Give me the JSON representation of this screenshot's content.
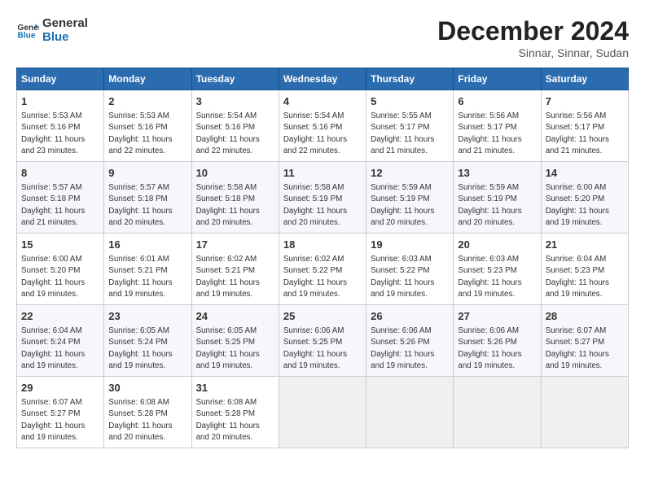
{
  "logo": {
    "line1": "General",
    "line2": "Blue"
  },
  "title": "December 2024",
  "subtitle": "Sinnar, Sinnar, Sudan",
  "days_of_week": [
    "Sunday",
    "Monday",
    "Tuesday",
    "Wednesday",
    "Thursday",
    "Friday",
    "Saturday"
  ],
  "weeks": [
    [
      {
        "day": "1",
        "info": "Sunrise: 5:53 AM\nSunset: 5:16 PM\nDaylight: 11 hours\nand 23 minutes."
      },
      {
        "day": "2",
        "info": "Sunrise: 5:53 AM\nSunset: 5:16 PM\nDaylight: 11 hours\nand 22 minutes."
      },
      {
        "day": "3",
        "info": "Sunrise: 5:54 AM\nSunset: 5:16 PM\nDaylight: 11 hours\nand 22 minutes."
      },
      {
        "day": "4",
        "info": "Sunrise: 5:54 AM\nSunset: 5:16 PM\nDaylight: 11 hours\nand 22 minutes."
      },
      {
        "day": "5",
        "info": "Sunrise: 5:55 AM\nSunset: 5:17 PM\nDaylight: 11 hours\nand 21 minutes."
      },
      {
        "day": "6",
        "info": "Sunrise: 5:56 AM\nSunset: 5:17 PM\nDaylight: 11 hours\nand 21 minutes."
      },
      {
        "day": "7",
        "info": "Sunrise: 5:56 AM\nSunset: 5:17 PM\nDaylight: 11 hours\nand 21 minutes."
      }
    ],
    [
      {
        "day": "8",
        "info": "Sunrise: 5:57 AM\nSunset: 5:18 PM\nDaylight: 11 hours\nand 21 minutes."
      },
      {
        "day": "9",
        "info": "Sunrise: 5:57 AM\nSunset: 5:18 PM\nDaylight: 11 hours\nand 20 minutes."
      },
      {
        "day": "10",
        "info": "Sunrise: 5:58 AM\nSunset: 5:18 PM\nDaylight: 11 hours\nand 20 minutes."
      },
      {
        "day": "11",
        "info": "Sunrise: 5:58 AM\nSunset: 5:19 PM\nDaylight: 11 hours\nand 20 minutes."
      },
      {
        "day": "12",
        "info": "Sunrise: 5:59 AM\nSunset: 5:19 PM\nDaylight: 11 hours\nand 20 minutes."
      },
      {
        "day": "13",
        "info": "Sunrise: 5:59 AM\nSunset: 5:19 PM\nDaylight: 11 hours\nand 20 minutes."
      },
      {
        "day": "14",
        "info": "Sunrise: 6:00 AM\nSunset: 5:20 PM\nDaylight: 11 hours\nand 19 minutes."
      }
    ],
    [
      {
        "day": "15",
        "info": "Sunrise: 6:00 AM\nSunset: 5:20 PM\nDaylight: 11 hours\nand 19 minutes."
      },
      {
        "day": "16",
        "info": "Sunrise: 6:01 AM\nSunset: 5:21 PM\nDaylight: 11 hours\nand 19 minutes."
      },
      {
        "day": "17",
        "info": "Sunrise: 6:02 AM\nSunset: 5:21 PM\nDaylight: 11 hours\nand 19 minutes."
      },
      {
        "day": "18",
        "info": "Sunrise: 6:02 AM\nSunset: 5:22 PM\nDaylight: 11 hours\nand 19 minutes."
      },
      {
        "day": "19",
        "info": "Sunrise: 6:03 AM\nSunset: 5:22 PM\nDaylight: 11 hours\nand 19 minutes."
      },
      {
        "day": "20",
        "info": "Sunrise: 6:03 AM\nSunset: 5:23 PM\nDaylight: 11 hours\nand 19 minutes."
      },
      {
        "day": "21",
        "info": "Sunrise: 6:04 AM\nSunset: 5:23 PM\nDaylight: 11 hours\nand 19 minutes."
      }
    ],
    [
      {
        "day": "22",
        "info": "Sunrise: 6:04 AM\nSunset: 5:24 PM\nDaylight: 11 hours\nand 19 minutes."
      },
      {
        "day": "23",
        "info": "Sunrise: 6:05 AM\nSunset: 5:24 PM\nDaylight: 11 hours\nand 19 minutes."
      },
      {
        "day": "24",
        "info": "Sunrise: 6:05 AM\nSunset: 5:25 PM\nDaylight: 11 hours\nand 19 minutes."
      },
      {
        "day": "25",
        "info": "Sunrise: 6:06 AM\nSunset: 5:25 PM\nDaylight: 11 hours\nand 19 minutes."
      },
      {
        "day": "26",
        "info": "Sunrise: 6:06 AM\nSunset: 5:26 PM\nDaylight: 11 hours\nand 19 minutes."
      },
      {
        "day": "27",
        "info": "Sunrise: 6:06 AM\nSunset: 5:26 PM\nDaylight: 11 hours\nand 19 minutes."
      },
      {
        "day": "28",
        "info": "Sunrise: 6:07 AM\nSunset: 5:27 PM\nDaylight: 11 hours\nand 19 minutes."
      }
    ],
    [
      {
        "day": "29",
        "info": "Sunrise: 6:07 AM\nSunset: 5:27 PM\nDaylight: 11 hours\nand 19 minutes."
      },
      {
        "day": "30",
        "info": "Sunrise: 6:08 AM\nSunset: 5:28 PM\nDaylight: 11 hours\nand 20 minutes."
      },
      {
        "day": "31",
        "info": "Sunrise: 6:08 AM\nSunset: 5:28 PM\nDaylight: 11 hours\nand 20 minutes."
      },
      {
        "day": "",
        "info": ""
      },
      {
        "day": "",
        "info": ""
      },
      {
        "day": "",
        "info": ""
      },
      {
        "day": "",
        "info": ""
      }
    ]
  ]
}
